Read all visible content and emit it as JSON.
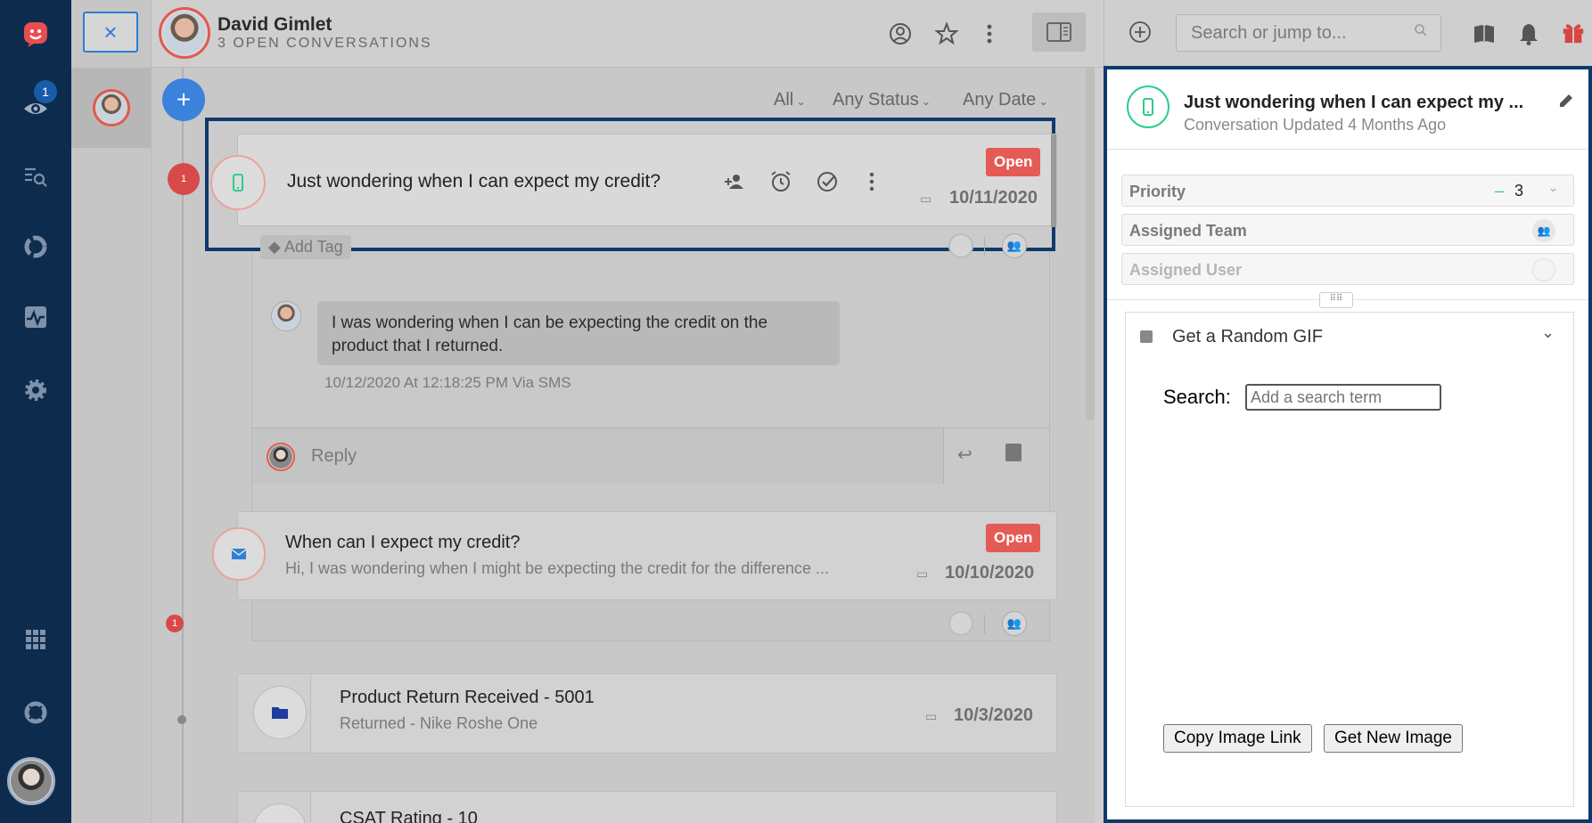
{
  "nav": {
    "badge_count": "1",
    "icons": [
      "app-logo-icon",
      "eye-icon",
      "search-list-icon",
      "reports-icon",
      "activity-icon",
      "settings-icon",
      "apps-grid-icon",
      "help-icon",
      "user-avatar"
    ]
  },
  "customer_list": {
    "close_label": "×"
  },
  "header": {
    "name": "David Gimlet",
    "subtitle": "3 OPEN CONVERSATIONS"
  },
  "topbar": {
    "search_placeholder": "Search or jump to..."
  },
  "timeline": {
    "add_label": "+",
    "filters": [
      "All",
      "Any Status",
      "Any Date"
    ],
    "conversation1": {
      "badge": "1",
      "title": "Just wondering when I can expect my credit?",
      "status": "Open",
      "date": "10/11/2020",
      "add_tag": "Add Tag",
      "message": "I was wondering when I can be expecting the credit on the product that I returned.",
      "message_meta": "10/12/2020 At 12:18:25 PM Via SMS",
      "reply_placeholder": "Reply"
    },
    "conversation2": {
      "badge": "1",
      "title": "When can I expect my credit?",
      "preview": "Hi, I was wondering when I might be expecting the credit for the difference ...",
      "status": "Open",
      "date": "10/10/2020"
    },
    "event1": {
      "title": "Product Return Received - 5001",
      "subtitle": "Returned - Nike Roshe One",
      "date": "10/3/2020"
    },
    "event2": {
      "title": "CSAT Rating - 10"
    }
  },
  "right_panel": {
    "title": "Just wondering when I can expect my ...",
    "updated": "Conversation Updated 4 Months Ago",
    "priority_label": "Priority",
    "priority_dash": "–",
    "priority_value": "3",
    "assigned_team_label": "Assigned Team",
    "assigned_user_label": "Assigned User",
    "gif_title": "Get a Random GIF",
    "search_label": "Search:",
    "search_placeholder": "Add a search term",
    "copy_button": "Copy Image Link",
    "new_button": "Get New Image"
  },
  "colors": {
    "nav_bg": "#0d2b4d",
    "accent_blue": "#2e7bd8",
    "status_red": "#e45b55",
    "sms_green": "#2ecc8a",
    "panel_border": "#0e3a6b"
  }
}
